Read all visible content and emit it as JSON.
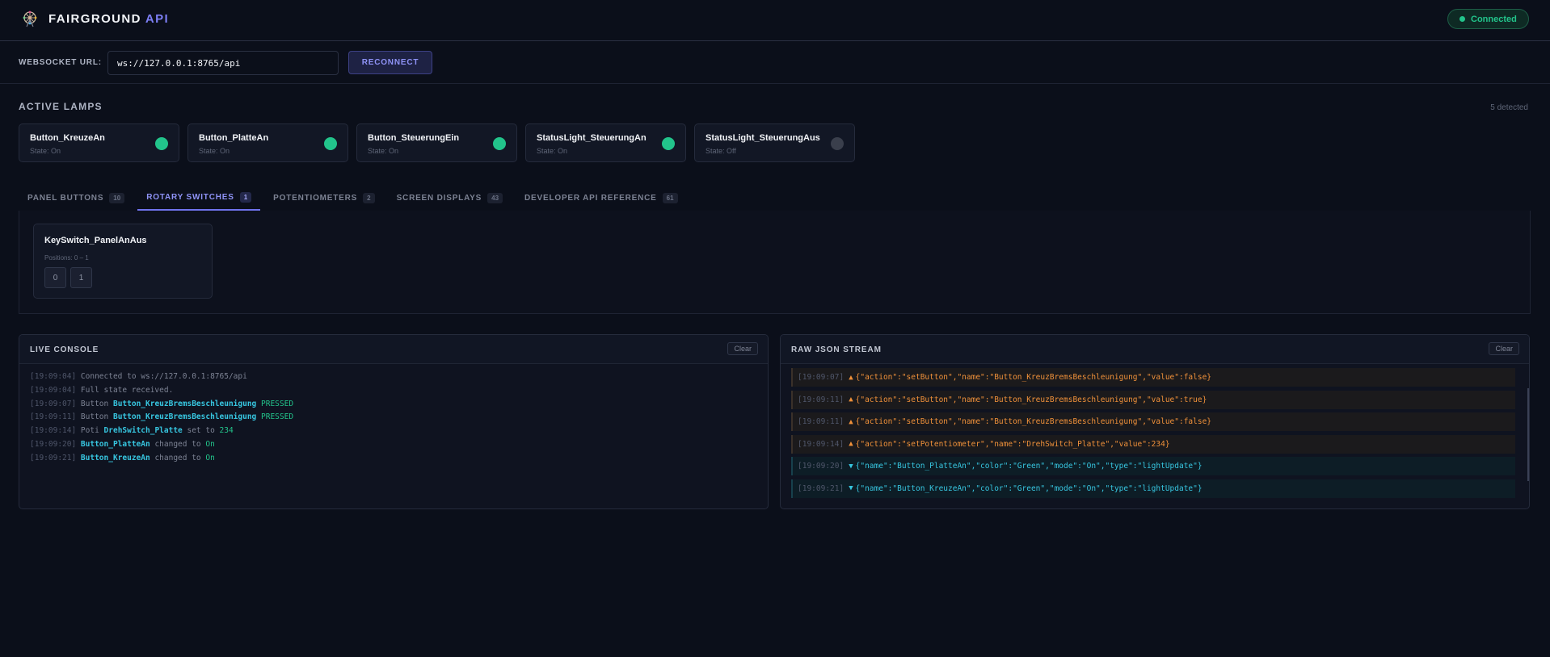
{
  "header": {
    "brand_main": "FAIRGROUND",
    "brand_accent": "API",
    "status": "Connected",
    "colors": {
      "accent": "#7d7ff5",
      "connected": "#22c48b"
    }
  },
  "connection": {
    "label": "WEBSOCKET URL:",
    "url": "ws://127.0.0.1:8765/api",
    "reconnect_label": "RECONNECT"
  },
  "lamps": {
    "title": "ACTIVE LAMPS",
    "detected": "5 detected",
    "items": [
      {
        "name": "Button_KreuzeAn",
        "state": "State: On",
        "on": true
      },
      {
        "name": "Button_PlatteAn",
        "state": "State: On",
        "on": true
      },
      {
        "name": "Button_SteuerungEin",
        "state": "State: On",
        "on": true
      },
      {
        "name": "StatusLight_SteuerungAn",
        "state": "State: On",
        "on": true
      },
      {
        "name": "StatusLight_SteuerungAus",
        "state": "State: Off",
        "on": false
      }
    ]
  },
  "tabs": [
    {
      "label": "PANEL BUTTONS",
      "count": "10",
      "active": false
    },
    {
      "label": "ROTARY SWITCHES",
      "count": "1",
      "active": true
    },
    {
      "label": "POTENTIOMETERS",
      "count": "2",
      "active": false
    },
    {
      "label": "SCREEN DISPLAYS",
      "count": "43",
      "active": false
    },
    {
      "label": "DEVELOPER API REFERENCE",
      "count": "61",
      "active": false
    }
  ],
  "rotary": {
    "name": "KeySwitch_PanelAnAus",
    "positions_label": "Positions: 0 – 1",
    "positions": [
      "0",
      "1"
    ]
  },
  "console": {
    "title": "LIVE CONSOLE",
    "clear_label": "Clear",
    "lines": [
      [
        {
          "t": "[19:09:04] ",
          "c": "ts"
        },
        {
          "t": "Connected to ws://127.0.0.1:8765/api",
          "c": "dim"
        }
      ],
      [
        {
          "t": "[19:09:04] ",
          "c": "ts"
        },
        {
          "t": "Full state received.",
          "c": "dim"
        }
      ],
      [
        {
          "t": "[19:09:07] ",
          "c": "ts"
        },
        {
          "t": "Button ",
          "c": "dim"
        },
        {
          "t": "Button_KreuzBremsBeschleunigung",
          "c": "cyan"
        },
        {
          "t": " PRESSED",
          "c": "green"
        }
      ],
      [
        {
          "t": "[19:09:11] ",
          "c": "ts"
        },
        {
          "t": "Button ",
          "c": "dim"
        },
        {
          "t": "Button_KreuzBremsBeschleunigung",
          "c": "cyan"
        },
        {
          "t": " PRESSED",
          "c": "green"
        }
      ],
      [
        {
          "t": "[19:09:14] ",
          "c": "ts"
        },
        {
          "t": "Poti ",
          "c": "dim"
        },
        {
          "t": "DrehSwitch_Platte",
          "c": "cyan"
        },
        {
          "t": " set to ",
          "c": "dim"
        },
        {
          "t": "234",
          "c": "green"
        }
      ],
      [
        {
          "t": "[19:09:20] ",
          "c": "ts"
        },
        {
          "t": "Button_PlatteAn",
          "c": "cyan"
        },
        {
          "t": " changed to ",
          "c": "dim"
        },
        {
          "t": "On",
          "c": "green"
        }
      ],
      [
        {
          "t": "[19:09:21] ",
          "c": "ts"
        },
        {
          "t": "Button_KreuzeAn",
          "c": "cyan"
        },
        {
          "t": " changed to ",
          "c": "dim"
        },
        {
          "t": "On",
          "c": "green"
        }
      ]
    ]
  },
  "json_stream": {
    "title": "RAW JSON STREAM",
    "clear_label": "Clear",
    "rows": [
      {
        "ts": "[19:09:07]",
        "dir": "out",
        "arrow": "▲",
        "payload": "{\"action\":\"setButton\",\"name\":\"Button_KreuzBremsBeschleunigung\",\"value\":false}"
      },
      {
        "ts": "[19:09:11]",
        "dir": "out",
        "arrow": "▲",
        "payload": "{\"action\":\"setButton\",\"name\":\"Button_KreuzBremsBeschleunigung\",\"value\":true}"
      },
      {
        "ts": "[19:09:11]",
        "dir": "out",
        "arrow": "▲",
        "payload": "{\"action\":\"setButton\",\"name\":\"Button_KreuzBremsBeschleunigung\",\"value\":false}"
      },
      {
        "ts": "[19:09:14]",
        "dir": "out",
        "arrow": "▲",
        "payload": "{\"action\":\"setPotentiometer\",\"name\":\"DrehSwitch_Platte\",\"value\":234}"
      },
      {
        "ts": "[19:09:20]",
        "dir": "in",
        "arrow": "▼",
        "payload": "{\"name\":\"Button_PlatteAn\",\"color\":\"Green\",\"mode\":\"On\",\"type\":\"lightUpdate\"}"
      },
      {
        "ts": "[19:09:21]",
        "dir": "in",
        "arrow": "▼",
        "payload": "{\"name\":\"Button_KreuzeAn\",\"color\":\"Green\",\"mode\":\"On\",\"type\":\"lightUpdate\"}"
      }
    ]
  },
  "icons": {
    "logo": "ferris-wheel-icon"
  }
}
